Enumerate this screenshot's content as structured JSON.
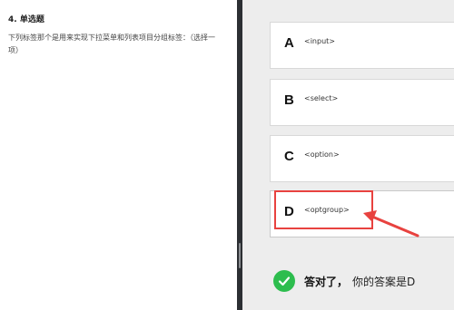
{
  "question": {
    "title": "4. 单选题",
    "text": "下列标签那个是用来实现下拉菜单和列表项目分组标签：（选择一项）"
  },
  "options": [
    {
      "letter": "A",
      "text": "<input>"
    },
    {
      "letter": "B",
      "text": "<select>"
    },
    {
      "letter": "C",
      "text": "<option>"
    },
    {
      "letter": "D",
      "text": "<optgroup>"
    }
  ],
  "result": {
    "correct_label": "答对了，",
    "answer_text": "你的答案是D",
    "status_color": "#2dbd4e",
    "icon": "check-circle-icon"
  },
  "annotation": {
    "highlight_color": "#e8423f",
    "arrow_icon": "red-arrow-icon"
  }
}
